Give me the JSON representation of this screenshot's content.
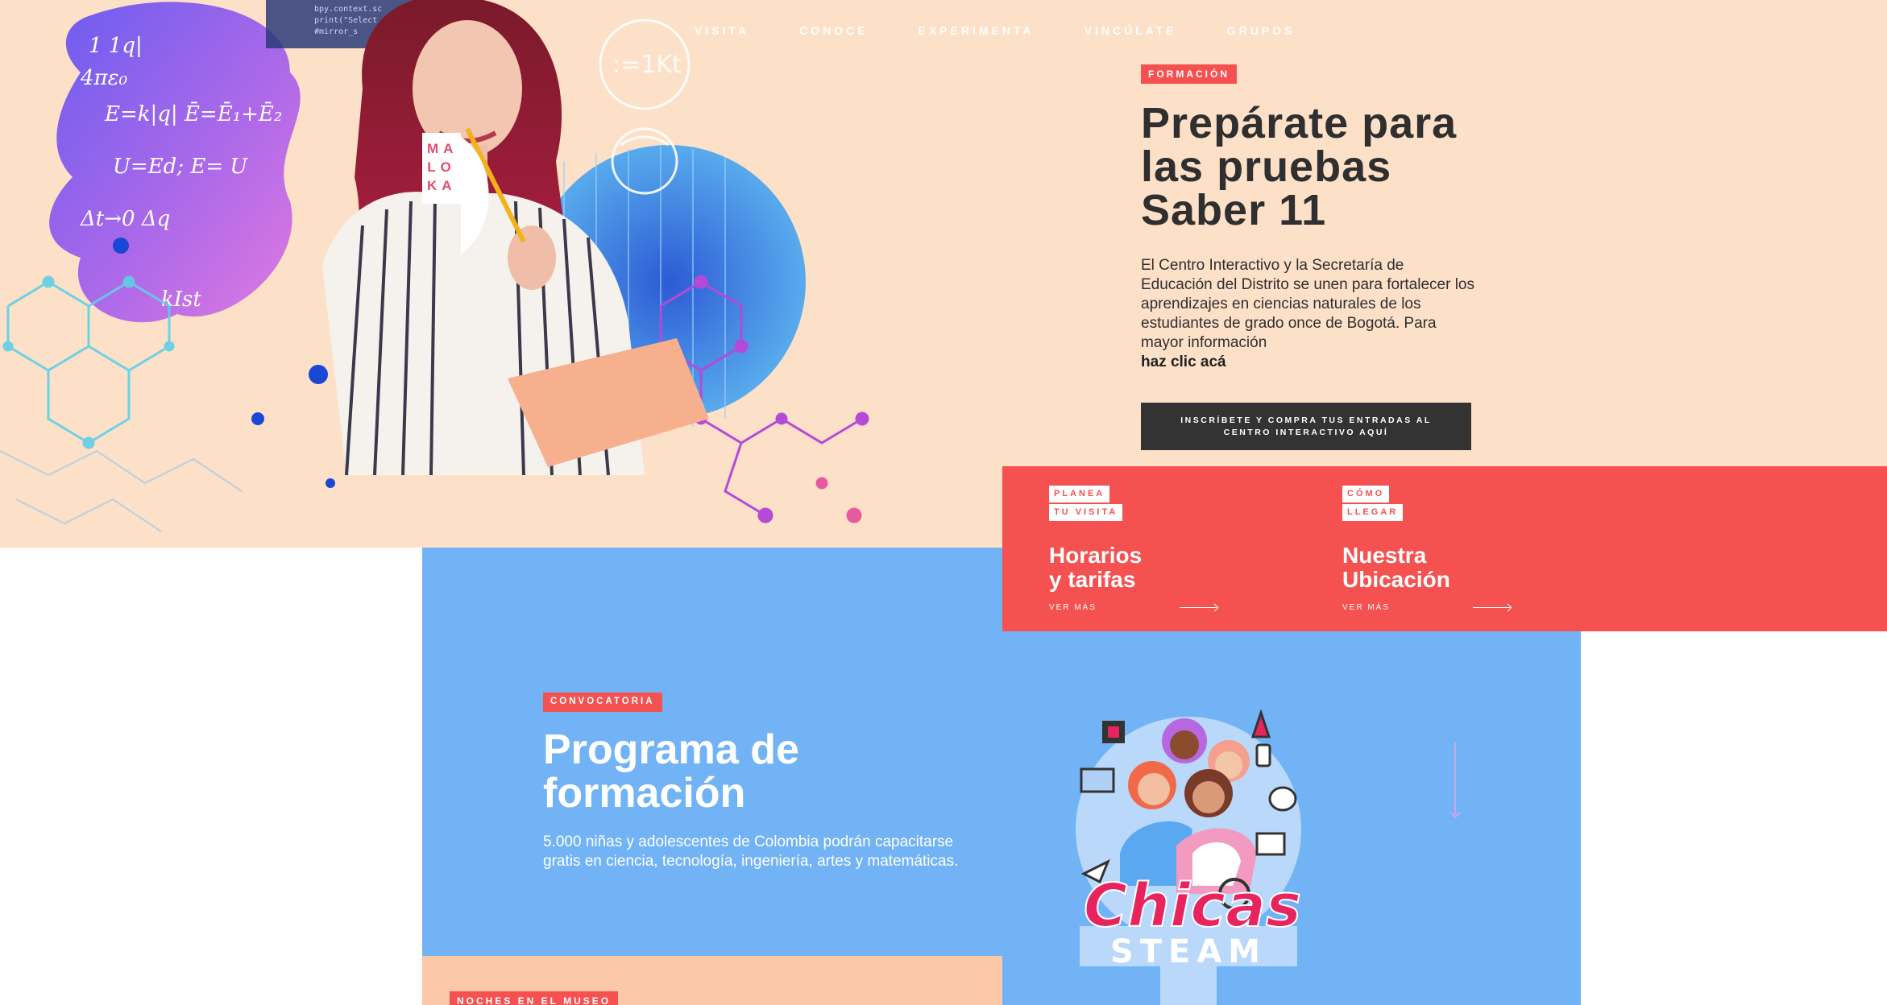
{
  "nav": {
    "items": [
      "VISITA",
      "CONOCE",
      "EXPERIMENTA",
      "VINCÚLATE",
      "GRUPOS"
    ]
  },
  "logo": {
    "letters": [
      "MA",
      "LO",
      "KA"
    ]
  },
  "hero": {
    "tag": "FORMACIÓN",
    "title_lines": [
      "Prepárate para",
      "las pruebas",
      "Saber 11"
    ],
    "description": "El Centro Interactivo y la Secretaría de Educación del Distrito se unen para fortalecer los aprendizajes en ciencias naturales de los estudiantes de grado once de Bogotá. Para mayor información",
    "link": "haz clic acá",
    "cta_lines": [
      "INSCRÍBETE Y COMPRA TUS ENTRADAS AL",
      "CENTRO INTERACTIVO AQUÍ"
    ]
  },
  "info": {
    "cards": [
      {
        "tag_lines": [
          "PLANEA",
          "TU VISITA"
        ],
        "title_lines": [
          "Horarios",
          "y tarifas"
        ],
        "more": "VER MÁS"
      },
      {
        "tag_lines": [
          "CÓMO",
          "LLEGAR"
        ],
        "title_lines": [
          "Nuestra",
          "Ubicación"
        ],
        "more": "VER MÁS"
      }
    ]
  },
  "program": {
    "tag": "CONVOCATORIA",
    "title_lines": [
      "Programa de",
      "formación"
    ],
    "description": "5.000 niñas y adolescentes de Colombia podrán capacitarse gratis en ciencia, tecnología, ingeniería, artes y matemáticas."
  },
  "chicas": {
    "word1": "Chicas",
    "word2": "STEAM"
  },
  "night": {
    "tag": "NOCHES EN EL MUSEO"
  },
  "colors": {
    "peach": "#fde0c8",
    "red": "#f55151",
    "blue": "#72b3f5",
    "dark": "#333333",
    "pink": "#e8245f"
  }
}
